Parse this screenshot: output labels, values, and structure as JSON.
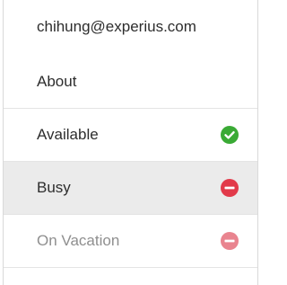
{
  "account": {
    "email": "chihung@experius.com"
  },
  "menu": {
    "about_label": "About"
  },
  "statuses": [
    {
      "label": "Available",
      "icon": "check-circle-icon",
      "color": "#3aaa35",
      "state": "normal"
    },
    {
      "label": "Busy",
      "icon": "minus-circle-icon",
      "color": "#e23a4a",
      "state": "hovered"
    },
    {
      "label": "On Vacation",
      "icon": "minus-circle-icon",
      "color": "#e9848f",
      "state": "dimmed"
    }
  ]
}
